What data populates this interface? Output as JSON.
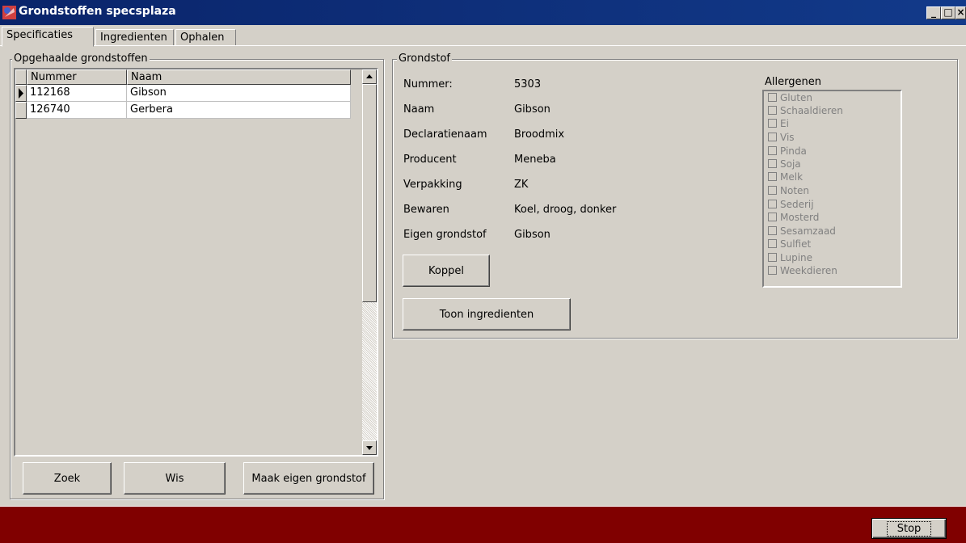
{
  "window": {
    "title": "Grondstoffen specsplaza",
    "minimize_glyph": "_",
    "maximize_glyph": "□",
    "close_glyph": "×"
  },
  "tabs": [
    {
      "label": "Specificaties",
      "active": true
    },
    {
      "label": "Ingredienten",
      "active": false
    },
    {
      "label": "Ophalen",
      "active": false
    }
  ],
  "left_panel": {
    "title": "Opgehaalde grondstoffen",
    "columns": [
      "Nummer",
      "Naam"
    ],
    "rows": [
      {
        "nummer": "112168",
        "naam": "Gibson",
        "selected": true
      },
      {
        "nummer": "126740",
        "naam": "Gerbera",
        "selected": false
      }
    ],
    "buttons": {
      "zoek": "Zoek",
      "wis": "Wis",
      "maak": "Maak eigen grondstof"
    }
  },
  "grondstof": {
    "title": "Grondstof",
    "fields": [
      {
        "label": "Nummer:",
        "value": "5303"
      },
      {
        "label": "Naam",
        "value": "Gibson"
      },
      {
        "label": "Declaratienaam",
        "value": "Broodmix"
      },
      {
        "label": "Producent",
        "value": "Meneba"
      },
      {
        "label": "Verpakking",
        "value": "ZK"
      },
      {
        "label": "Bewaren",
        "value": "Koel, droog, donker"
      },
      {
        "label": "Eigen grondstof",
        "value": "Gibson"
      }
    ],
    "koppel_label": "Koppel",
    "toon_label": "Toon ingredienten",
    "allergenen": {
      "title": "Allergenen",
      "items": [
        "Gluten",
        "Schaaldieren",
        "Ei",
        "Vis",
        "Pinda",
        "Soja",
        "Melk",
        "Noten",
        "Sederij",
        "Mosterd",
        "Sesamzaad",
        "Sulfiet",
        "Lupine",
        "Weekdieren"
      ]
    }
  },
  "footer": {
    "stop_label": "Stop",
    "background": "#800000"
  },
  "colors": {
    "titlebar": "#0a246a",
    "face": "#d4d0c8"
  }
}
